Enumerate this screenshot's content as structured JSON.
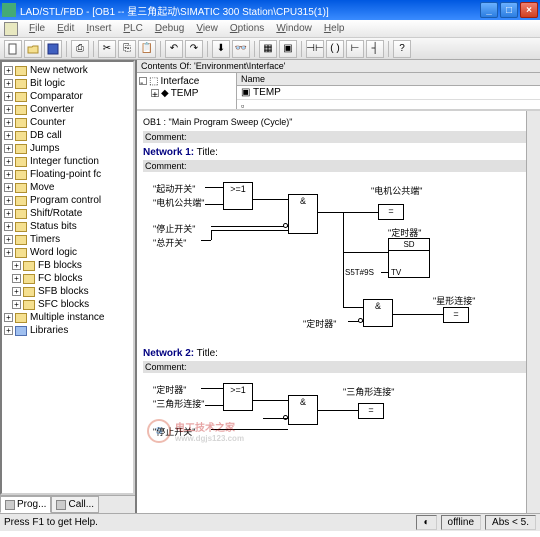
{
  "window": {
    "title": "LAD/STL/FBD  - [OB1 -- 星三角起动\\SIMATIC 300 Station\\CPU315(1)]"
  },
  "menu": [
    "File",
    "Edit",
    "Insert",
    "PLC",
    "Debug",
    "View",
    "Options",
    "Window",
    "Help"
  ],
  "tree": {
    "items": [
      "New network",
      "Bit logic",
      "Comparator",
      "Converter",
      "Counter",
      "DB call",
      "Jumps",
      "Integer function",
      "Floating-point fc",
      "Move",
      "Program control",
      "Shift/Rotate",
      "Status bits",
      "Timers",
      "Word logic",
      "FB blocks",
      "FC blocks",
      "SFB blocks",
      "SFC blocks",
      "Multiple instance",
      "Libraries"
    ]
  },
  "tabs": {
    "t1": "Prog...",
    "t2": "Call..."
  },
  "interface": {
    "header": "Contents Of: 'Environment\\Interface'",
    "root": "Interface",
    "child": "TEMP",
    "col": "Name",
    "val": "TEMP"
  },
  "ob": {
    "title": "OB1 : \"Main Program Sweep (Cycle)\"",
    "comment": "Comment:",
    "net1": "Network 1:",
    "net1_title": "Title:",
    "net2": "Network 2:",
    "net2_title": "Title:"
  },
  "fbd1": {
    "in1": "\"起动开关\"",
    "in2": "\"电机公共端\"",
    "in3": "\"停止开关\"",
    "in4": "\"总开关\"",
    "out1": "\"电机公共端\"",
    "out1_op": "=",
    "timer": "\"定时器\"",
    "timer_type": "SD",
    "timer_tv": "S5T#9S",
    "timer_tv_lbl": "TV",
    "in5": "\"定时器\"",
    "out2": "\"星形连接\"",
    "out2_op": "=",
    "gate_or": ">=1",
    "gate_and": "&",
    "neg_o": "o"
  },
  "fbd2": {
    "in1": "\"定时器\"",
    "in2": "\"三角形连接\"",
    "in3": "\"停止开关\"",
    "out1": "\"三角形连接\"",
    "out1_op": "=",
    "gate_or": ">=1",
    "gate_and": "&",
    "neg_o": "o"
  },
  "status": {
    "help": "Press F1 to get Help.",
    "offline": "offline",
    "abs": "Abs < 5."
  },
  "watermark": {
    "text": "电工技术之家",
    "sub": "www.dgjs123.com"
  }
}
